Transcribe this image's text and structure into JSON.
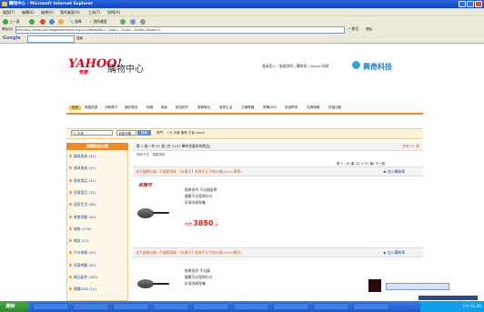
{
  "window": {
    "title": "購物中心 - Microsoft Internet Explorer"
  },
  "menu": [
    "檔案(F)",
    "編輯(E)",
    "檢視(V)",
    "我的最愛(A)",
    "工具(T)",
    "說明(H)"
  ],
  "toolbar": {
    "back": "上一頁",
    "search": "搜尋",
    "favorites": "我的最愛"
  },
  "address": {
    "label": "網址(D)",
    "url": "http://buy.yahoo.com.tw/gdsale/search.asp?p=pfbeoe&kb=...&sbs=...&sub=...&code=0&sbo=0",
    "go": "移至",
    "links": "連結"
  },
  "google": {
    "label": "Google",
    "search_btn": "搜尋"
  },
  "site": {
    "logo": "YAHOO!",
    "logo_sub": "奇摩",
    "logo_text": "購物中心",
    "top_links": "會員登入 | 服務說明 | 購物車 | Yahoo!奇摩",
    "brand": "興奇科技"
  },
  "nav_tabs": [
    "首頁",
    "電腦週邊",
    "消費電子",
    "通訊電信",
    "相機",
    "美妝",
    "精品配件",
    "服飾鞋包",
    "居家生活",
    "交通電器",
    "書籍DVD",
    "旅遊票券",
    "品牌旗艦",
    "特價活動"
  ],
  "search": {
    "value": "平底",
    "scope": "全部分類",
    "button": "搜尋",
    "hot": "熱門：一元 手機 筆電 平板 coach"
  },
  "sidebar": {
    "title": "相關商品分類",
    "items": [
      "鍋具廚具 (42)",
      "餐具廚具 (37)",
      "廚房用品 (41)",
      "家電用品 (32)",
      "居家生活 (56)",
      "美食保健 (45)",
      "服飾 (176)",
      "美妝 (27)",
      "戶外休閒 (29)",
      "家電視聽 (55)",
      "精品配件 (163)",
      "書籍DVD (11)"
    ]
  },
  "results": {
    "summary": "第 1 頁～共 57 頁 (共 1137 筆符合要求的商品)",
    "filter": "排序方式：價格排序",
    "pager": "第 1 - 20 筆 (共 1137 筆) 下一頁",
    "page_count": "共有 57 頁",
    "products": [
      {
        "title": "送不鏽鋼炒鍋+不鏽鋼湯碗 【米雅可】經典不沾平底炒鍋(30cm單把)",
        "add": "▶ 加入購物車",
        "features": [
          "經典系列 不沾鍋塗層",
          "健康不沾導熱均勻",
          "好清洗易保養"
        ],
        "price_label": "特價",
        "price": "3850",
        "price_unit": "元"
      },
      {
        "title": "送不鏽鋼炒鍋+不鏽鋼湯碗 【米雅可】經典不沾平底炒鍋(30cm雙耳)",
        "add": "▶ 加入購物車",
        "features": [
          "經典系列 不沾鍋",
          "健康不沾導熱均勻",
          "好清洗易保養"
        ]
      }
    ]
  },
  "taskbar": {
    "start": "開始",
    "clock": "下午 02:08"
  }
}
